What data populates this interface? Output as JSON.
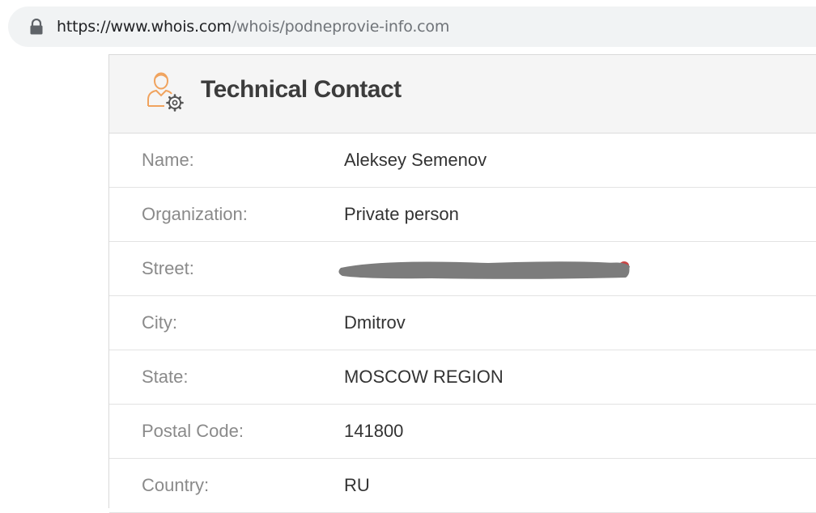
{
  "browser": {
    "url_host": "https://www.whois.com",
    "url_path": "/whois/podneprovie-info.com"
  },
  "panel": {
    "title": "Technical Contact",
    "icon": "contact-settings-icon",
    "accent_color": "#f0a35e",
    "rows": [
      {
        "label": "Name:",
        "value": "Aleksey Semenov"
      },
      {
        "label": "Organization:",
        "value": "Private person"
      },
      {
        "label": "Street:",
        "value": "",
        "redacted": true
      },
      {
        "label": "City:",
        "value": "Dmitrov"
      },
      {
        "label": "State:",
        "value": "MOSCOW REGION"
      },
      {
        "label": "Postal Code:",
        "value": "141800"
      },
      {
        "label": "Country:",
        "value": "RU"
      }
    ]
  }
}
